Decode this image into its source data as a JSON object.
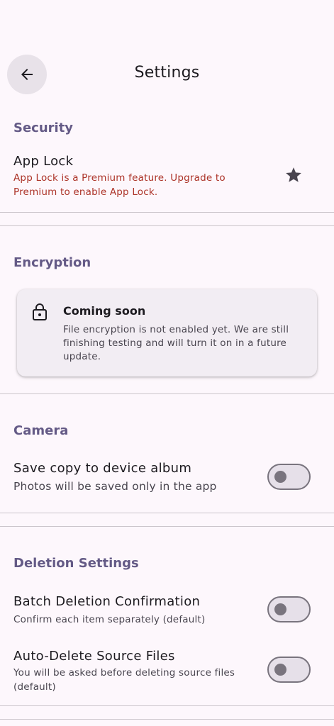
{
  "header": {
    "title": "Settings"
  },
  "security": {
    "header": "Security",
    "app_lock_title": "App Lock",
    "app_lock_note": "App Lock is a Premium feature. Upgrade to Premium to enable App Lock."
  },
  "encryption": {
    "header": "Encryption",
    "card_title": "Coming soon",
    "card_body": "File encryption is not enabled yet. We are still finishing testing and will turn it on in a future update."
  },
  "camera": {
    "header": "Camera",
    "save_copy_title": "Save copy to device album",
    "save_copy_sub": "Photos will be saved only in the app",
    "save_copy_on": false
  },
  "deletion": {
    "header": "Deletion Settings",
    "batch_title": "Batch Deletion Confirmation",
    "batch_sub": "Confirm each item separately (default)",
    "batch_on": false,
    "auto_title": "Auto-Delete Source Files",
    "auto_sub": "You will be asked before deleting source files (default)",
    "auto_on": false
  },
  "icons": {
    "back": "arrow-back-icon",
    "premium": "star-icon",
    "lock": "lock-icon"
  },
  "colors": {
    "background": "#fdf7fc",
    "section_header": "#645a86",
    "error": "#ac3328",
    "switch_track": "#e6e0e9",
    "switch_outline": "#79747e"
  }
}
